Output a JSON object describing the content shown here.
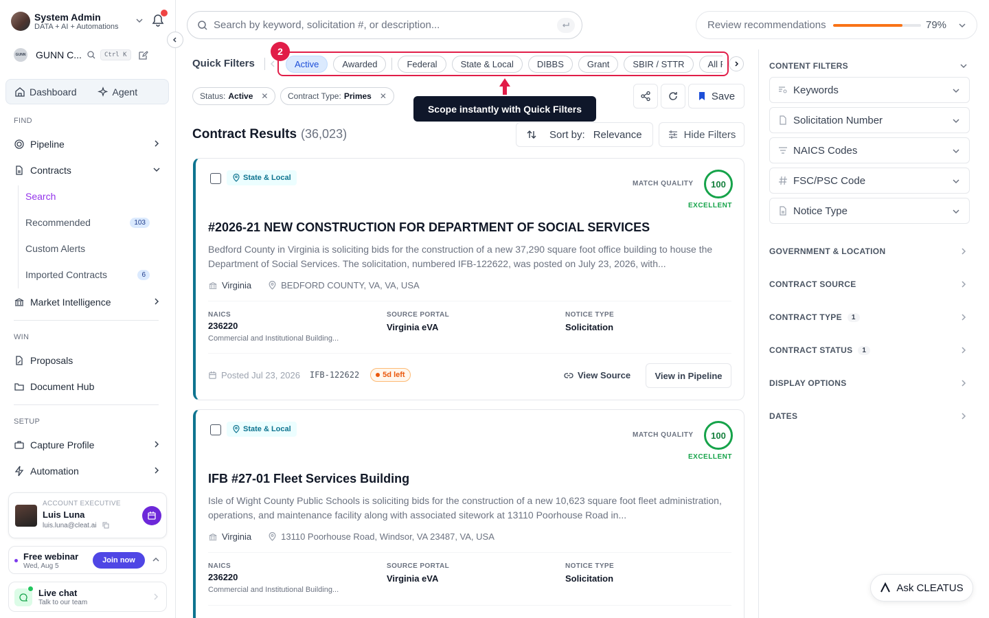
{
  "user": {
    "name": "System Admin",
    "subtitle": "DATA + AI + Automations"
  },
  "org": {
    "logo_text": "GUNN",
    "name": "GUNN C...",
    "shortcut": "Ctrl K"
  },
  "tabs": {
    "dashboard": "Dashboard",
    "agent": "Agent"
  },
  "sections": {
    "find": "FIND",
    "win": "WIN",
    "setup": "SETUP"
  },
  "nav": {
    "pipeline": "Pipeline",
    "contracts": "Contracts",
    "contracts_sub": [
      {
        "label": "Search"
      },
      {
        "label": "Recommended",
        "count": "103"
      },
      {
        "label": "Custom Alerts"
      },
      {
        "label": "Imported Contracts",
        "count": "6"
      }
    ],
    "market_intelligence": "Market Intelligence",
    "proposals": "Proposals",
    "document_hub": "Document Hub",
    "capture_profile": "Capture Profile",
    "automation": "Automation"
  },
  "account_exec": {
    "label": "ACCOUNT EXECUTIVE",
    "name": "Luis Luna",
    "email": "luis.luna@cleat.ai"
  },
  "webinar": {
    "title": "Free webinar",
    "date": "Wed, Aug 5",
    "cta": "Join now"
  },
  "live_chat": {
    "title": "Live chat",
    "subtitle": "Talk to our team"
  },
  "search": {
    "placeholder": "Search by keyword, solicitation #, or description..."
  },
  "review": {
    "label": "Review recommendations",
    "percent_text": "79%",
    "progress": 0.79
  },
  "quick_filters": {
    "label": "Quick Filters",
    "chips": [
      "Active",
      "Awarded",
      "Federal",
      "State & Local",
      "DIBBS",
      "Grant",
      "SBIR / STTR",
      "All Forecasts"
    ],
    "active": "Active"
  },
  "tour": {
    "step": "2",
    "tooltip": "Scope instantly with Quick Filters"
  },
  "active_tags": [
    {
      "key": "Status:",
      "value": "Active"
    },
    {
      "key": "Contract Type:",
      "value": "Primes"
    }
  ],
  "actions": {
    "save": "Save",
    "sort_label": "Sort by:",
    "sort_value": "Relevance",
    "hide_filters": "Hide Filters"
  },
  "results": {
    "title": "Contract Results",
    "count": "(36,023)"
  },
  "cards": [
    {
      "badge": "State & Local",
      "match_label": "MATCH QUALITY",
      "score": "100",
      "quality": "EXCELLENT",
      "title": "#2026-21 NEW CONSTRUCTION FOR DEPARTMENT OF SOCIAL SERVICES",
      "description": "Bedford County in Virginia is soliciting bids for the construction of a new 37,290 square foot office building to house the Department of Social Services. The solicitation, numbered IFB-122622, was posted on July 23, 2026, with...",
      "state": "Virginia",
      "address": "BEDFORD COUNTY, VA, VA, USA",
      "naics_label": "NAICS",
      "naics": "236220",
      "naics_desc": "Commercial and Institutional Building...",
      "portal_label": "SOURCE PORTAL",
      "portal": "Virginia eVA",
      "notice_label": "NOTICE TYPE",
      "notice": "Solicitation",
      "posted": "Posted Jul 23, 2026",
      "solicitation_id": "IFB-122622",
      "days_left": "5d left",
      "view_source": "View Source",
      "view_pipeline": "View in Pipeline"
    },
    {
      "badge": "State & Local",
      "match_label": "MATCH QUALITY",
      "score": "100",
      "quality": "EXCELLENT",
      "title": "IFB #27-01 Fleet Services Building",
      "description": "Isle of Wight County Public Schools is soliciting bids for the construction of a new 10,623 square foot fleet administration, operations, and maintenance facility along with associated sitework at 13110 Poorhouse Road in...",
      "state": "Virginia",
      "address": "13110 Poorhouse Road, Windsor, VA 23487, VA, USA",
      "naics_label": "NAICS",
      "naics": "236220",
      "naics_desc": "Commercial and Institutional Building...",
      "portal_label": "SOURCE PORTAL",
      "portal": "Virginia eVA",
      "notice_label": "NOTICE TYPE",
      "notice": "Solicitation"
    }
  ],
  "filters_panel": {
    "content_filters": "CONTENT FILTERS",
    "selects": [
      "Keywords",
      "Solicitation Number",
      "NAICS Codes",
      "FSC/PSC Code",
      "Notice Type"
    ],
    "groups": [
      {
        "label": "GOVERNMENT & LOCATION"
      },
      {
        "label": "CONTRACT SOURCE"
      },
      {
        "label": "CONTRACT TYPE",
        "count": "1"
      },
      {
        "label": "CONTRACT STATUS",
        "count": "1"
      },
      {
        "label": "DISPLAY OPTIONS"
      },
      {
        "label": "DATES"
      }
    ]
  },
  "ask": {
    "label": "Ask CLEATUS"
  },
  "colors": {
    "accent": "#9333ea",
    "tour": "#e11d48",
    "match": "#16a34a",
    "card_border": "#0e7490",
    "progress": "#f97316"
  }
}
